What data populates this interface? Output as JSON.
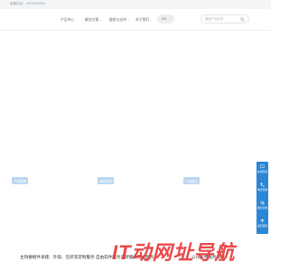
{
  "topbar": {
    "hotline": "客服热线：400-0000000"
  },
  "nav": {
    "items": [
      {
        "label": "产品中心"
      },
      {
        "label": "解决方案"
      },
      {
        "label": "服务与支持"
      },
      {
        "label": "关于我们"
      }
    ],
    "language": "CN",
    "search_placeholder": "搜索产品名称"
  },
  "cards": [
    {
      "tag": "产品查看"
    },
    {
      "tag": "案例查看"
    },
    {
      "tag": "产品展示"
    }
  ],
  "descriptions": {
    "left": "主持做继件承建、外观、包装等定制服务",
    "middle": "自由软件服务品牌服务形式服务",
    "right": "公司业务服务领域"
  },
  "side_rail": {
    "items": [
      {
        "label": "在线咨询",
        "icon": "chat-icon"
      },
      {
        "label": "电话咨询",
        "icon": "phone-icon"
      },
      {
        "label": "微信咨询",
        "icon": "wechat-icon"
      },
      {
        "label": "返回顶部",
        "icon": "arrow-up-icon"
      }
    ]
  },
  "watermark": {
    "text": "IT动网址导航"
  },
  "colors": {
    "accent": "#2b86d6",
    "tag_bg": "#bcd6f0",
    "watermark": "#e83a3a"
  }
}
